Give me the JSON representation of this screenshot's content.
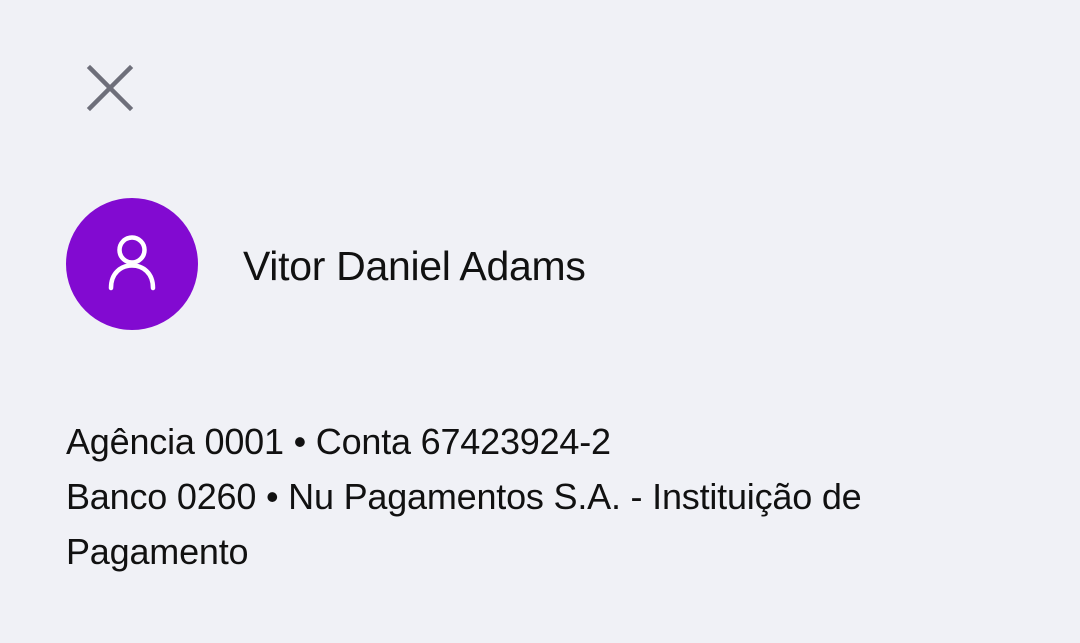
{
  "header": {
    "close_icon": "close-icon"
  },
  "contact": {
    "name": "Vitor Daniel Adams",
    "avatar_icon": "person-icon",
    "avatar_color": "#820ad1"
  },
  "account": {
    "line1": "Agência 0001 • Conta 67423924-2",
    "line2": "Banco 0260 • Nu Pagamentos S.A. - Instituição de Pagamento"
  },
  "colors": {
    "background": "#f0f1f6",
    "text": "#111111",
    "icon_gray": "#6e6f7a"
  }
}
